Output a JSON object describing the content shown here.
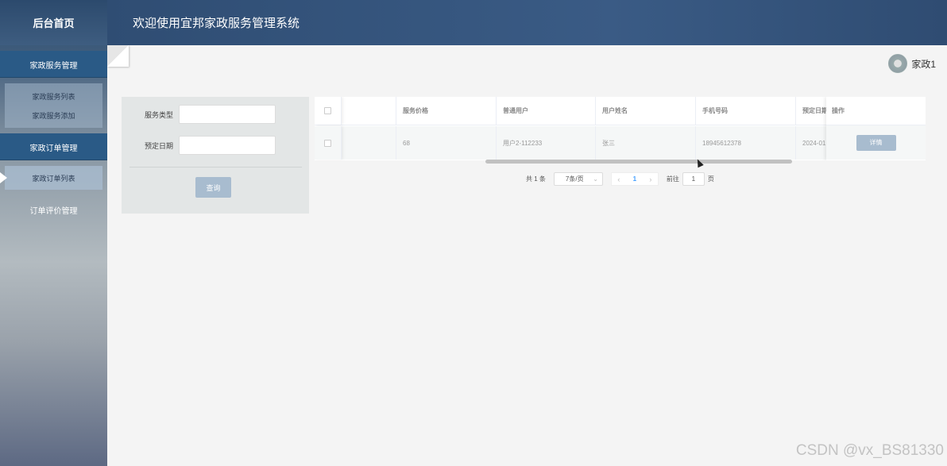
{
  "sidebar": {
    "home": "后台首页",
    "groups": [
      {
        "label": "家政服务管理",
        "items": [
          "家政服务列表",
          "家政服务添加"
        ]
      },
      {
        "label": "家政订单管理",
        "items": [
          "家政订单列表"
        ]
      },
      {
        "label": "订单评价管理",
        "items": []
      }
    ]
  },
  "header": {
    "title": "欢迎使用宜邦家政服务管理系统"
  },
  "user": {
    "name": "家政1",
    "avatar_icon": "avatar-icon"
  },
  "filter": {
    "service_type_label": "服务类型",
    "service_type_value": "",
    "reserve_date_label": "预定日期",
    "reserve_date_value": "",
    "query_button": "查询"
  },
  "table": {
    "columns": [
      "服务价格",
      "普通用户",
      "用户姓名",
      "手机号码",
      "预定日期",
      "操作"
    ],
    "rows": [
      {
        "price": "68",
        "user": "用户2-112233",
        "name": "张三",
        "phone": "18945612378",
        "date": "2024-01",
        "action": "详情"
      }
    ]
  },
  "pagination": {
    "total": "共 1 条",
    "page_size": "7条/页",
    "current_page": "1",
    "goto_label": "前往",
    "goto_value": "1",
    "page_suffix": "页"
  },
  "watermark": "CSDN @vx_BS81330",
  "colors": {
    "sidebar_active": "#2a5a86",
    "button": "#a8bccf",
    "accent": "#409eff"
  }
}
